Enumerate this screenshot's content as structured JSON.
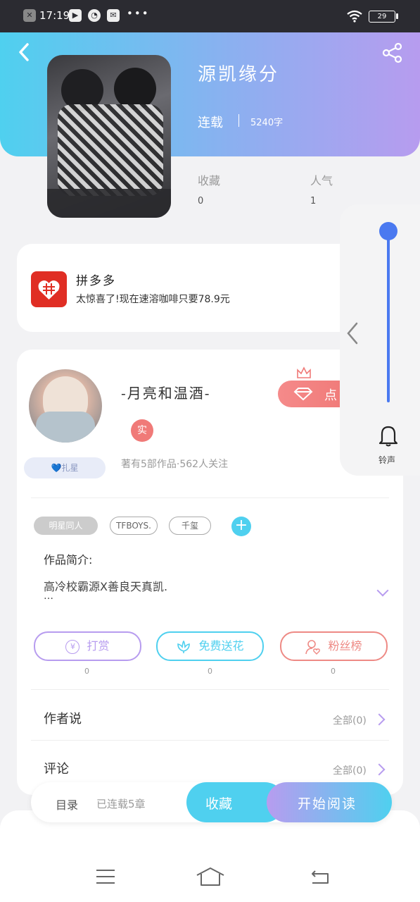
{
  "status_bar": {
    "time": "17:19",
    "dots": "•••",
    "battery": "29"
  },
  "header": {
    "title": "源凯缘分",
    "status": "连载",
    "word_count": "5240字"
  },
  "stats": {
    "fav_label": "收藏",
    "fav_value": "0",
    "pop_label": "人气",
    "pop_value": "1"
  },
  "ad": {
    "brand": "拼多多",
    "text": "太惊喜了!现在速溶咖啡只要78.9元"
  },
  "author": {
    "name": "-月亮和温酒-",
    "verified": "实",
    "meta": "著有5部作品·562人关注",
    "badge": "💙扎星",
    "vip_label": "点"
  },
  "tags": [
    "明星同人",
    "TFBOYS.",
    "千玺"
  ],
  "synopsis": {
    "label": "作品简介:",
    "text": "高冷校霸源X善良天真凯.",
    "more": "…"
  },
  "actions": [
    {
      "label": "打赏",
      "count": "0",
      "color": "#b79cef"
    },
    {
      "label": "免费送花",
      "count": "0",
      "color": "#4fd0ef"
    },
    {
      "label": "粉丝榜",
      "count": "0",
      "color": "#ee8a85"
    }
  ],
  "sections": [
    {
      "title": "作者说",
      "link": "全部(0)"
    },
    {
      "title": "评论",
      "link": "全部(0)"
    }
  ],
  "bottom_bar": {
    "toc": "目录",
    "serial": "已连载5章",
    "fav": "收藏",
    "read": "开始阅读"
  },
  "side_panel": {
    "ring_label": "铃声"
  }
}
